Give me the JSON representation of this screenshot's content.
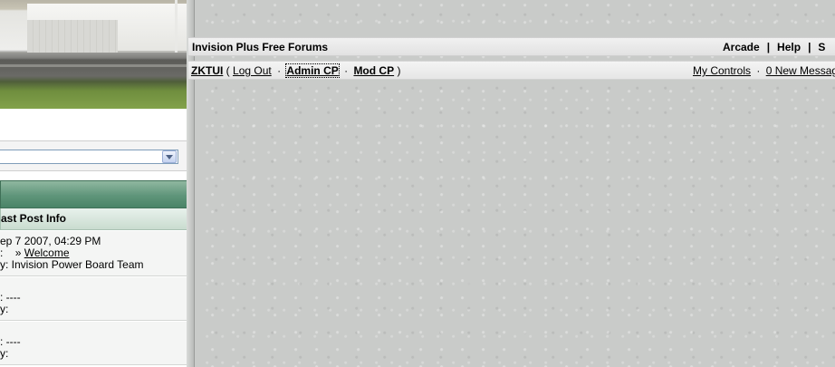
{
  "nav": {
    "site_title": "Invision Plus Free Forums",
    "links": [
      "Arcade",
      "Help",
      "S"
    ],
    "separator": "|"
  },
  "user_bar": {
    "username": "ZKTUI",
    "open_paren": "(",
    "log_out": "Log Out",
    "dot": "·",
    "admin_cp": "Admin CP",
    "mod_cp": "Mod CP",
    "close_paren": ")",
    "my_controls": "My Controls",
    "new_messages": "0 New Messag"
  },
  "forum": {
    "column_header": "ast Post Info",
    "rows": [
      {
        "line1": "ep 7 2007, 04:29 PM",
        "line2_prefix": ":",
        "line2_arrow": "»",
        "line2_link": "Welcome",
        "line3": "y: Invision Power Board Team"
      },
      {
        "line1": ": ----",
        "line2": "y:"
      },
      {
        "line1": ": ----",
        "line2": "y:"
      }
    ]
  },
  "icons": {
    "dropdown": "chevron-down-icon"
  },
  "colors": {
    "category_header": "#5f957a",
    "background": "#c9cbc9"
  }
}
